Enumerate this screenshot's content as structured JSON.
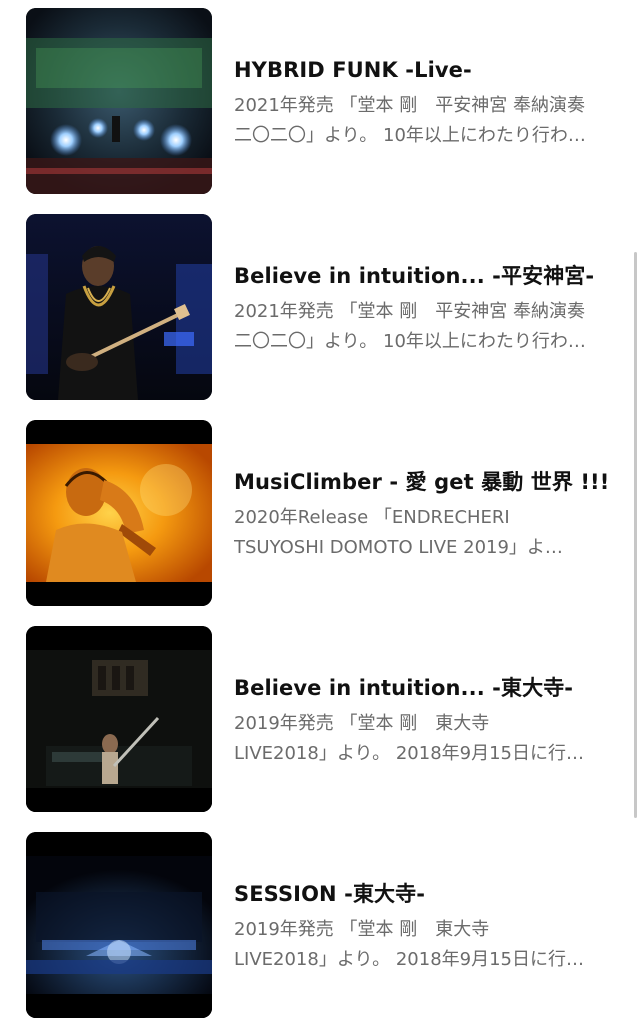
{
  "items": [
    {
      "title": "HYBRID FUNK -Live-",
      "desc_line1": "2021年発売 「堂本 剛　平安神宮 奉納演奏",
      "desc_line2": "二〇二〇」より。 10年以上にわたり行わ…",
      "thumb_icon": "concert-stage-lights-thumbnail"
    },
    {
      "title": "Believe in intuition... -平安神宮-",
      "desc_line1": "2021年発売 「堂本 剛　平安神宮 奉納演奏",
      "desc_line2": "二〇二〇」より。 10年以上にわたり行わ…",
      "thumb_icon": "bass-player-thumbnail"
    },
    {
      "title": "MusiClimber - 愛 get 暴動 世界 !!!",
      "desc_line1": "2020年Release 「ENDRECHERI",
      "desc_line2": "TSUYOSHI DOMOTO LIVE 2019」よ…",
      "thumb_icon": "orange-singer-thumbnail"
    },
    {
      "title": "Believe in intuition... -東大寺-",
      "desc_line1": "2019年発売 「堂本 剛　東大寺",
      "desc_line2": "LIVE2018」より。 2018年9月15日に行…",
      "thumb_icon": "temple-stage-thumbnail"
    },
    {
      "title": "SESSION -東大寺-",
      "desc_line1": "2019年発売 「堂本 剛　東大寺",
      "desc_line2": "LIVE2018」より。 2018年9月15日に行…",
      "thumb_icon": "blue-stage-thumbnail"
    }
  ]
}
